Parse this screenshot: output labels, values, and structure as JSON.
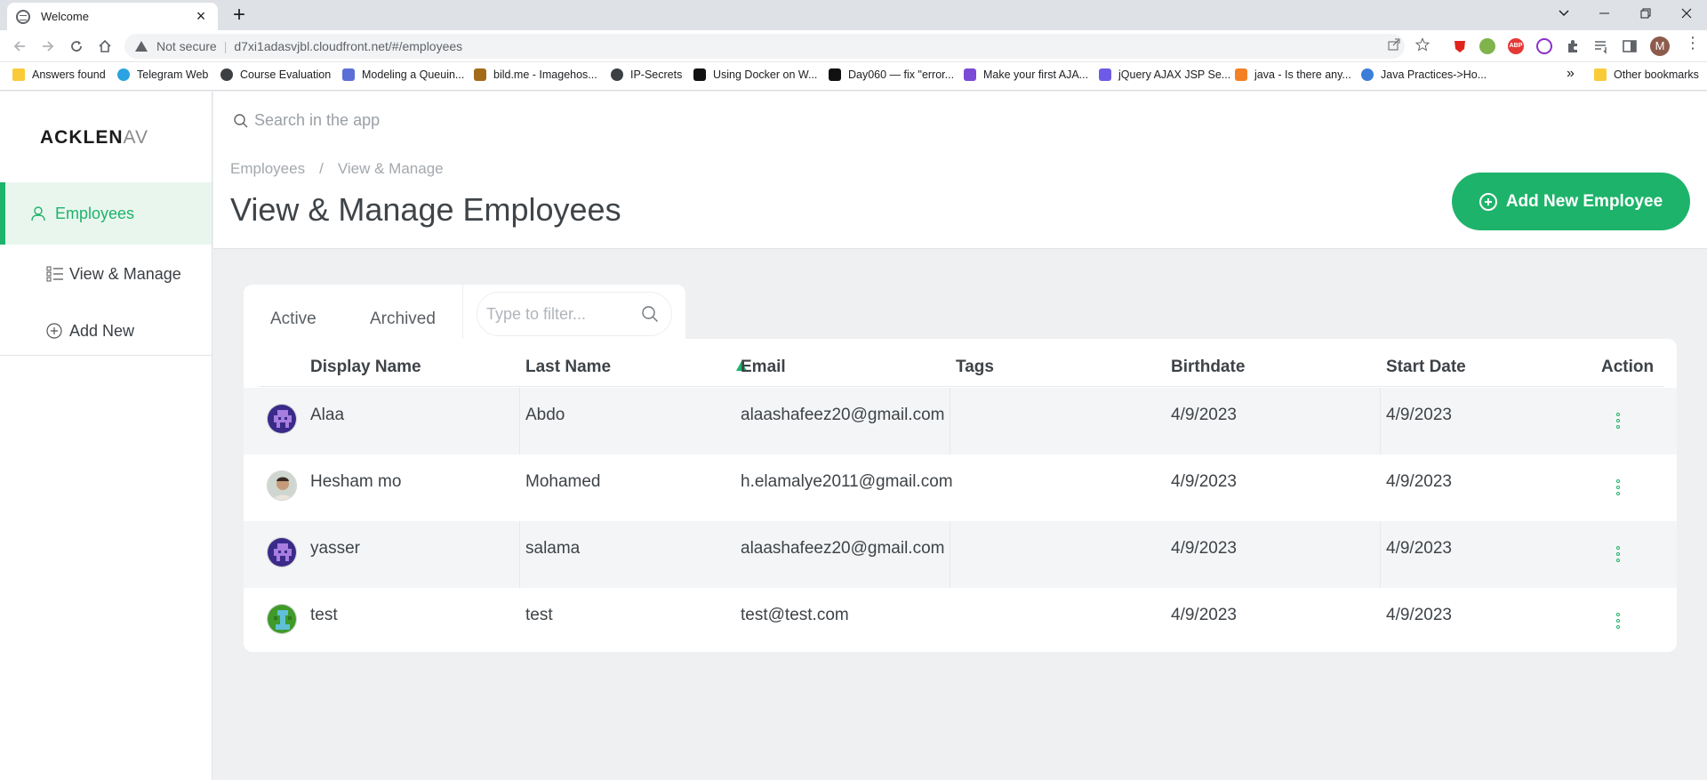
{
  "browser": {
    "tab_title": "Welcome",
    "tab_close": "×",
    "new_tab": "+",
    "not_secure": "Not secure",
    "url": "d7xi1adasvjbl.cloudfront.net/#/employees",
    "profile_initial": "M",
    "bookmarks": [
      {
        "label": "Answers found",
        "icon": "folder-icon",
        "color": "#f9cb39"
      },
      {
        "label": "Telegram Web",
        "icon": "telegram-icon",
        "color": "#2aa3e0"
      },
      {
        "label": "Course Evaluation",
        "icon": "globe-icon",
        "color": "#3c4043"
      },
      {
        "label": "Modeling a Queuin...",
        "icon": "doc-icon",
        "color": "#5b6fd6"
      },
      {
        "label": "bild.me - Imagehos...",
        "icon": "bild-icon",
        "color": "#a36a1a"
      },
      {
        "label": "IP-Secrets",
        "icon": "globe-icon",
        "color": "#3c4043"
      },
      {
        "label": "Using Docker on W...",
        "icon": "medium-icon",
        "color": "#111111"
      },
      {
        "label": "Day060 — fix \"error...",
        "icon": "medium-icon",
        "color": "#111111"
      },
      {
        "label": "Make your first AJA...",
        "icon": "d-icon",
        "color": "#7b4ad6"
      },
      {
        "label": "jQuery AJAX JSP Se...",
        "icon": "dd-icon",
        "color": "#6d5be8"
      },
      {
        "label": "java - Is there any...",
        "icon": "stackoverflow-icon",
        "color": "#f48024"
      },
      {
        "label": "Java Practices->Ho...",
        "icon": "jp-icon",
        "color": "#3b7dd8"
      }
    ],
    "more_bookmarks": "»",
    "other_bookmarks": "Other bookmarks"
  },
  "app": {
    "logo_main": "ACKLEN",
    "logo_fade": "AV",
    "search_placeholder": "Search in the app",
    "accent": "#1eb36b",
    "sidebar": {
      "items": [
        {
          "label": "Employees",
          "icon": "user-icon",
          "active": true
        },
        {
          "label": "View & Manage",
          "icon": "list-icon",
          "active": false
        },
        {
          "label": "Add New",
          "icon": "plus-circle-icon",
          "active": false
        }
      ]
    },
    "breadcrumb": {
      "parent": "Employees",
      "separator": "/",
      "current": "View & Manage"
    },
    "page_title": "View & Manage Employees",
    "add_button": "Add New Employee",
    "tabs": {
      "active": "Active",
      "archived": "Archived"
    },
    "filter_placeholder": "Type to filter...",
    "table": {
      "columns": [
        "Display Name",
        "Last Name",
        "Email",
        "Tags",
        "Birthdate",
        "Start Date",
        "Action"
      ],
      "sorted_column": "Email",
      "rows": [
        {
          "display_name": "Alaa",
          "last_name": "Abdo",
          "email": "alaashafeez20@gmail.com",
          "tags": "",
          "birthdate": "4/9/2023",
          "start_date": "4/9/2023",
          "avatar": "purple-identicon"
        },
        {
          "display_name": "Hesham mo",
          "last_name": "Mohamed",
          "email": "h.elamalye2011@gmail.com",
          "tags": "",
          "birthdate": "4/9/2023",
          "start_date": "4/9/2023",
          "avatar": "photo"
        },
        {
          "display_name": "yasser",
          "last_name": "salama",
          "email": "alaashafeez20@gmail.com",
          "tags": "",
          "birthdate": "4/9/2023",
          "start_date": "4/9/2023",
          "avatar": "purple-identicon"
        },
        {
          "display_name": "test",
          "last_name": "test",
          "email": "test@test.com",
          "tags": "",
          "birthdate": "4/9/2023",
          "start_date": "4/9/2023",
          "avatar": "green-identicon"
        }
      ]
    }
  }
}
